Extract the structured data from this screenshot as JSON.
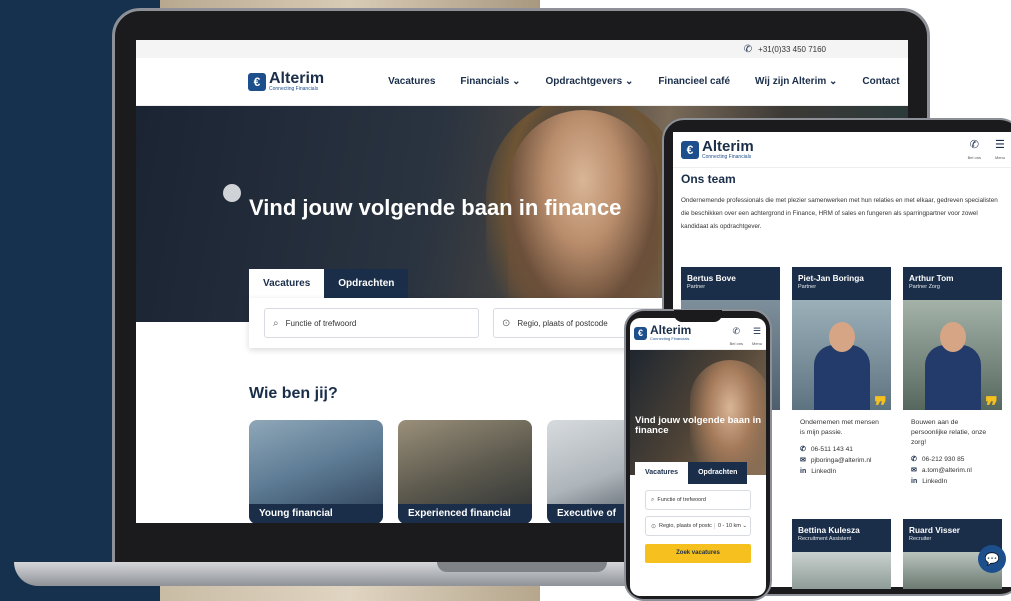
{
  "desktop": {
    "topbar": {
      "phone": "+31(0)33 450 7160"
    },
    "logo": {
      "name": "Alterim",
      "tagline": "Connecting Financials"
    },
    "nav": [
      "Vacatures",
      "Financials ⌄",
      "Opdrachtgevers ⌄",
      "Financieel café",
      "Wij zijn Alterim ⌄",
      "Contact"
    ],
    "hero": {
      "title": "Vind jouw volgende baan in finance"
    },
    "tabs": {
      "active": "Vacatures",
      "inactive": "Opdrachten"
    },
    "search": {
      "keyword_placeholder": "Functie of trefwoord",
      "location_placeholder": "Regio, plaats of postcode"
    },
    "who": {
      "heading": "Wie ben jij?",
      "cards": [
        "Young financial",
        "Experienced financial",
        "Executive of"
      ]
    }
  },
  "tablet": {
    "icons": {
      "phone_label": "Bel ons",
      "menu_label": "Menu"
    },
    "team": {
      "heading": "Ons team",
      "intro": "Ondernemende professionals die met plezier samenwerken met hun relaties en met elkaar, gedreven specialisten die beschikken over een achtergrond in Finance, HRM of sales en fungeren als sparringpartner voor zowel kandidaat als opdrachtgever.",
      "members": [
        {
          "name": "Bertus Bove",
          "role": "Partner"
        },
        {
          "name": "Piet-Jan Boringa",
          "role": "Partner",
          "quote": "Ondernemen met mensen is mijn passie.",
          "phone": "06-511 143 41",
          "email": "pjboringa@alterim.nl",
          "linkedin": "LinkedIn"
        },
        {
          "name": "Arthur Tom",
          "role": "Partner Zorg",
          "quote": "Bouwen aan de persoonlijke relatie, onze zorg!",
          "phone": "06-212 930 85",
          "email": "a.tom@alterim.nl",
          "linkedin": "LinkedIn"
        },
        {
          "name": "Bettina Kulesza",
          "role": "Recruitment Assistent"
        },
        {
          "name": "Ruard Visser",
          "role": "Recruiter"
        }
      ]
    }
  },
  "phone": {
    "hero_title": "Vind jouw volgende baan in finance",
    "tabs": {
      "active": "Vacatures",
      "inactive": "Opdrachten"
    },
    "keyword_placeholder": "Functie of trefwoord",
    "location_placeholder": "Regio, plaats of postc",
    "radius": "0 - 10 km ⌄",
    "search_button": "Zoek vacatures"
  },
  "colors": {
    "navy": "#1a2e4a",
    "brand_blue": "#1d4f8c",
    "accent_yellow": "#f6c11e"
  }
}
